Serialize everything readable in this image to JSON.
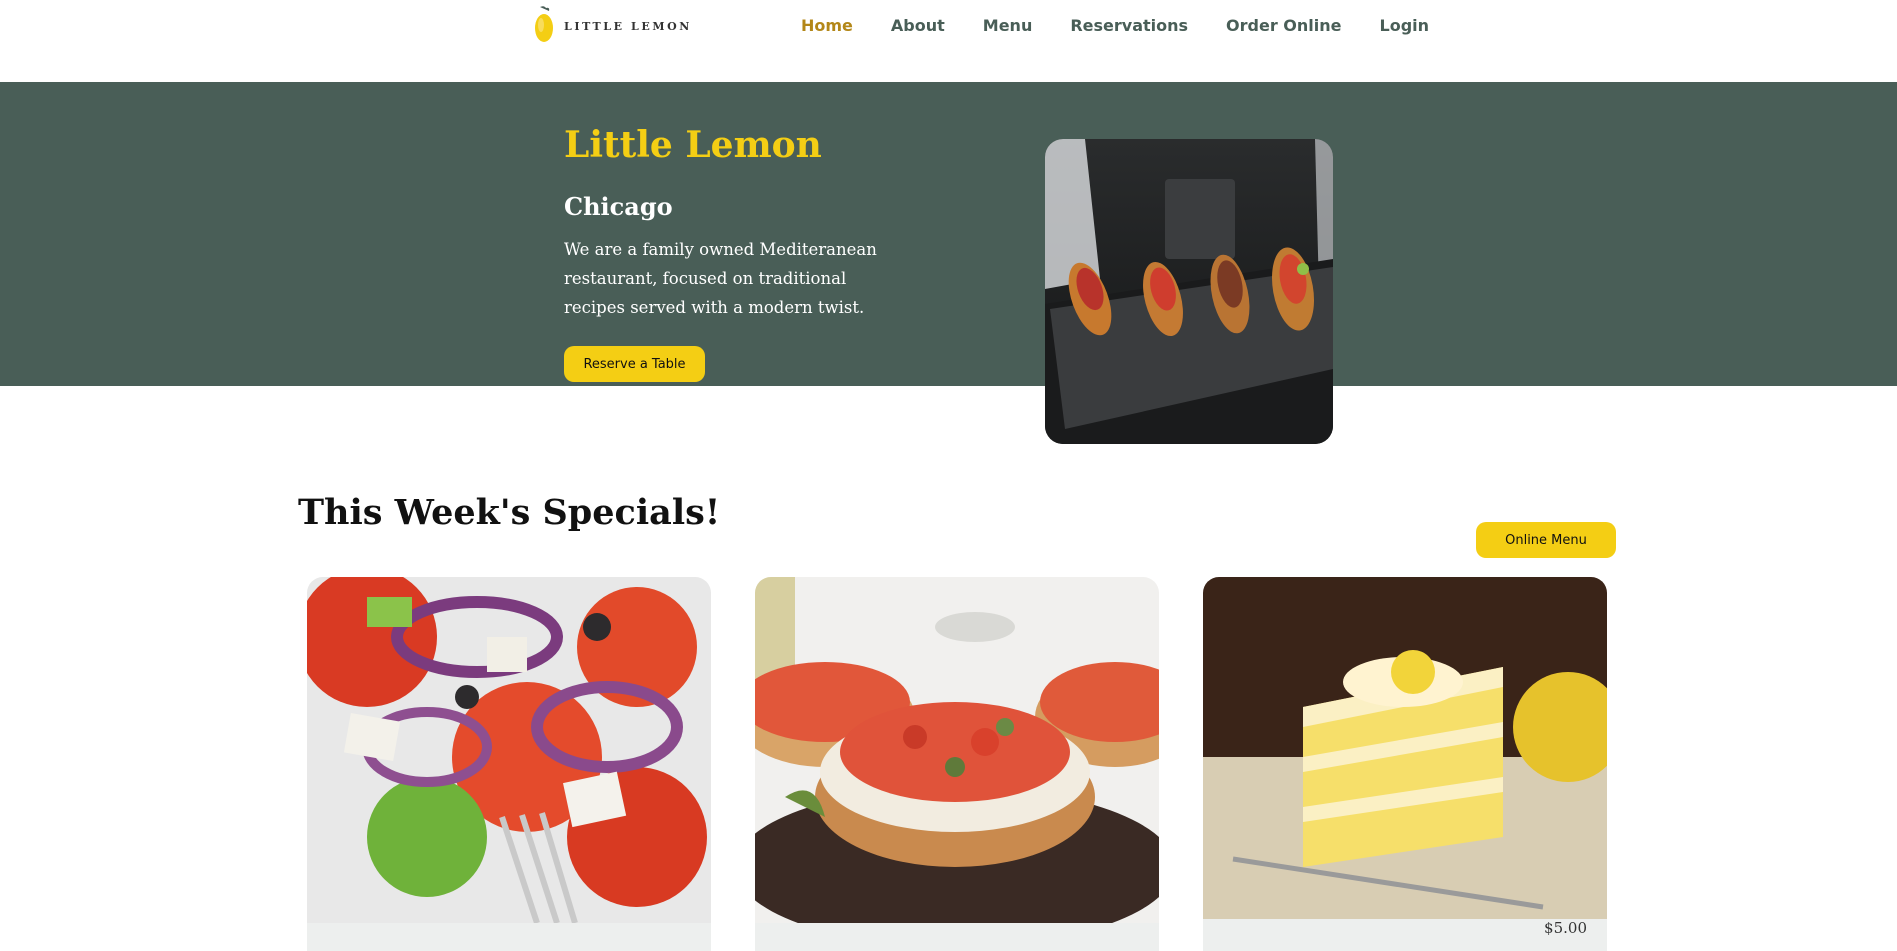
{
  "header": {
    "logo_text": "LITTLE LEMON",
    "nav": [
      {
        "label": "Home",
        "active": true
      },
      {
        "label": "About"
      },
      {
        "label": "Menu"
      },
      {
        "label": "Reservations"
      },
      {
        "label": "Order Online"
      },
      {
        "label": "Login"
      }
    ]
  },
  "hero": {
    "title": "Little Lemon",
    "subtitle": "Chicago",
    "description": "We are a family owned Mediteranean restaurant, focused on traditional recipes served with a modern twist.",
    "cta_label": "Reserve a Table"
  },
  "specials": {
    "title": "This Week's Specials!",
    "online_menu_label": "Online Menu",
    "cards": [
      {
        "name": "greek-salad",
        "price": ""
      },
      {
        "name": "bruschetta",
        "price": ""
      },
      {
        "name": "lemon-dessert",
        "price": "$5.00"
      }
    ]
  },
  "colors": {
    "primary_green": "#495E57",
    "primary_yellow": "#F4CE14",
    "active_nav": "#B38718",
    "card_bg": "#EDEFEE"
  },
  "icons": [
    "lemon-logo-icon"
  ]
}
